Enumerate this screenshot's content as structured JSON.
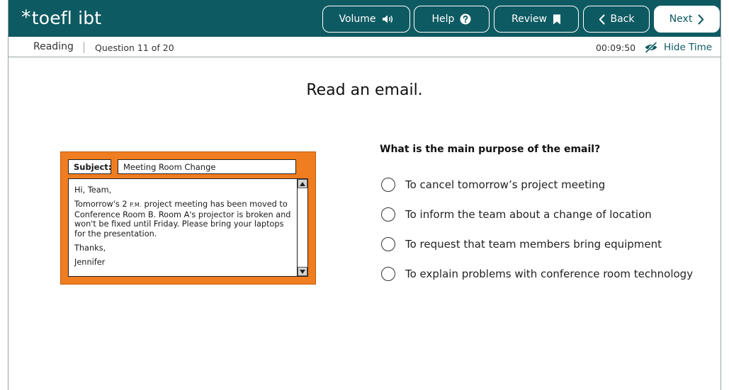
{
  "header": {
    "logo_text": "toefl ibt",
    "logo_star": "*",
    "buttons": {
      "volume": "Volume",
      "help": "Help",
      "review": "Review",
      "back": "Back",
      "next": "Next"
    },
    "colors": {
      "bar": "#0e5a62",
      "accent": "#f07d1f"
    }
  },
  "status": {
    "section": "Reading",
    "question_progress": "Question 11 of 20",
    "timer": "00:09:50",
    "hide_time_label": "Hide Time"
  },
  "task": {
    "title": "Read an email.",
    "email": {
      "subject_label": "Subject:",
      "subject_value": "Meeting Room Change",
      "greeting": "Hi, Team,",
      "body_before": "Tomorrow's 2",
      "body_time_mark": "P.M.",
      "body_after": "project meeting has been moved to Conference Room B. Room A's projector is broken and won't be fixed until Friday. Please bring your laptops for the presentation.",
      "closing": "Thanks,",
      "signature": "Jennifer"
    },
    "question": "What is the main purpose of the email?",
    "options": [
      "To cancel tomorrow’s project meeting",
      "To inform the team about a change of location",
      "To request that team members bring equipment",
      "To explain problems with conference room technology"
    ]
  }
}
